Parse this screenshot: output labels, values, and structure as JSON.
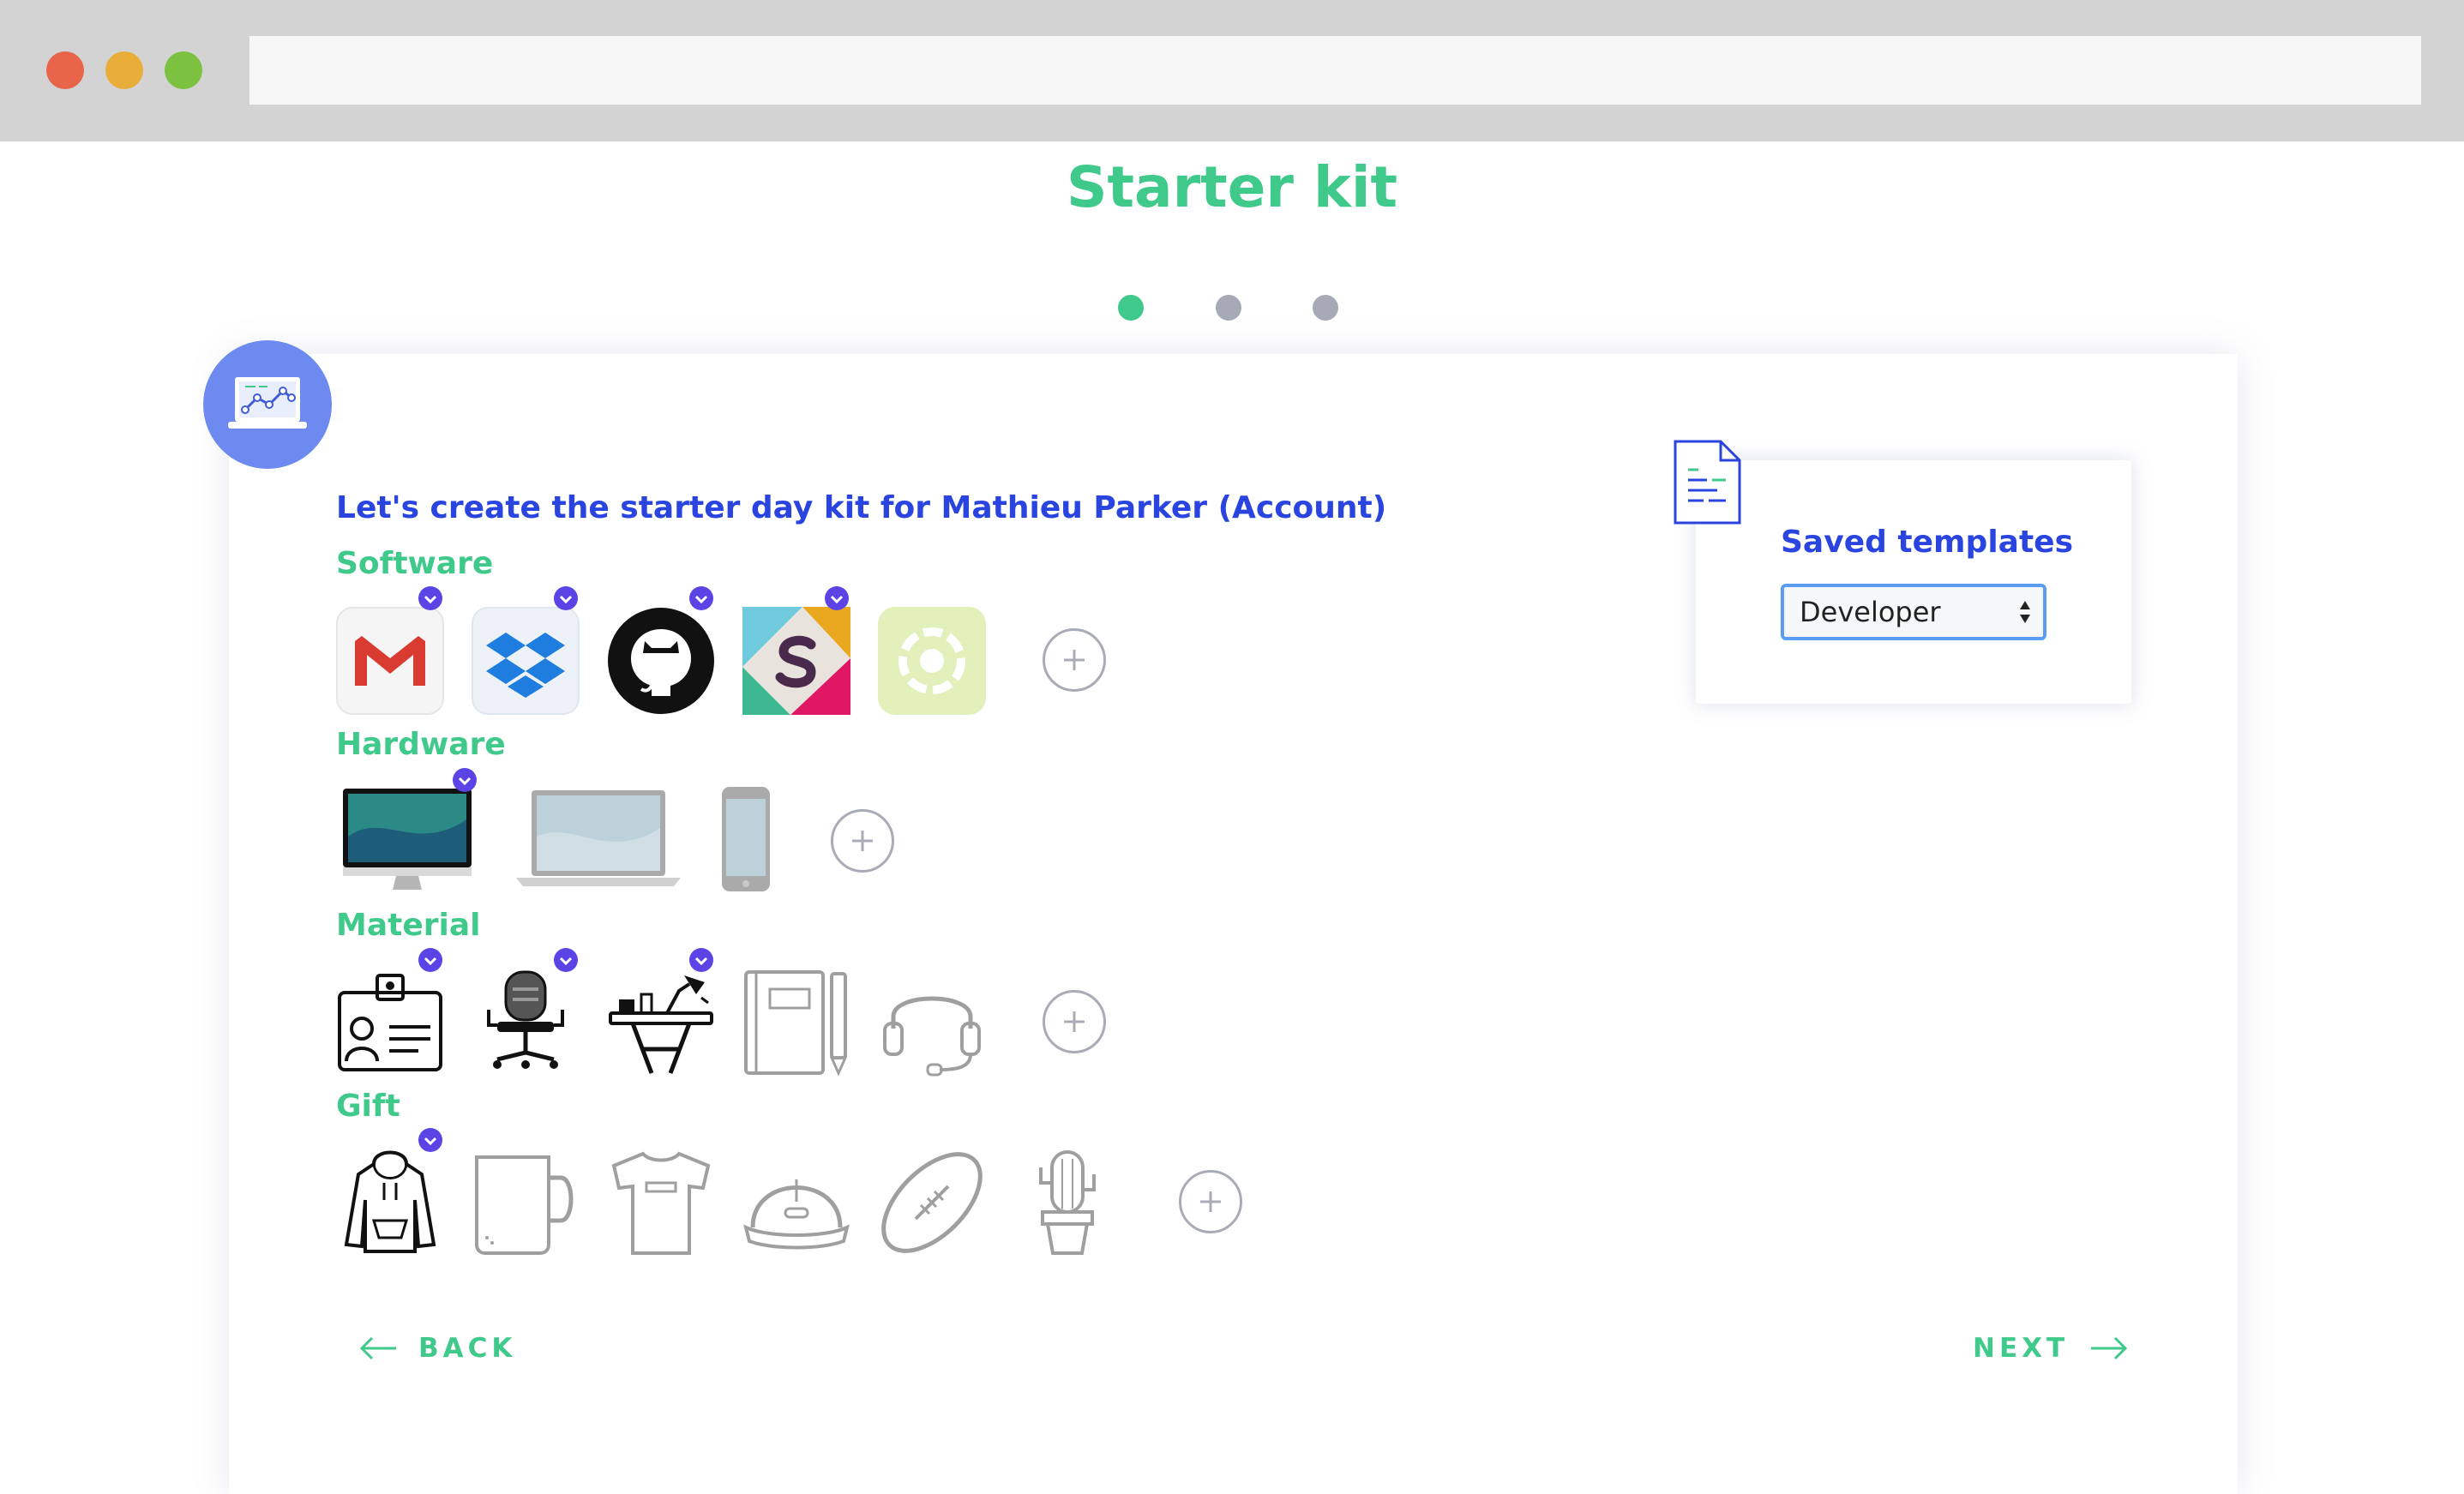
{
  "browser": {
    "address": ""
  },
  "page": {
    "title": "Starter kit"
  },
  "steps": {
    "total": 3,
    "current": 1
  },
  "intro": {
    "text": "Let's create the starter day kit for Mathieu Parker (Account)"
  },
  "sections": {
    "software": {
      "label": "Software",
      "items": [
        "Gmail",
        "Dropbox",
        "GitHub",
        "Slack",
        "Quip"
      ],
      "selected": [
        "Gmail",
        "Dropbox",
        "GitHub",
        "Slack"
      ]
    },
    "hardware": {
      "label": "Hardware",
      "items": [
        "iMac",
        "MacBook",
        "iPhone"
      ],
      "selected": [
        "iMac"
      ]
    },
    "material": {
      "label": "Material",
      "items": [
        "ID badge",
        "Office chair",
        "Desk",
        "Notebook",
        "Headset"
      ],
      "selected": [
        "ID badge",
        "Office chair",
        "Desk"
      ]
    },
    "gift": {
      "label": "Gift",
      "items": [
        "Hoodie",
        "Mug",
        "T-shirt",
        "Cap",
        "Football",
        "Cactus"
      ],
      "selected": [
        "Hoodie"
      ]
    }
  },
  "templates": {
    "label": "Saved templates",
    "selected": "Developer"
  },
  "nav": {
    "back_label": "BACK",
    "next_label": "NEXT"
  },
  "colors": {
    "accent_green": "#3fc98a",
    "accent_blue": "#2a44e0",
    "check_purple": "#5a44e6",
    "avatar_blue": "#6c8af0"
  },
  "icons": [
    "laptop-chart-icon",
    "document-icon",
    "check-icon",
    "plus-icon",
    "arrow-left-icon",
    "arrow-right-icon"
  ]
}
